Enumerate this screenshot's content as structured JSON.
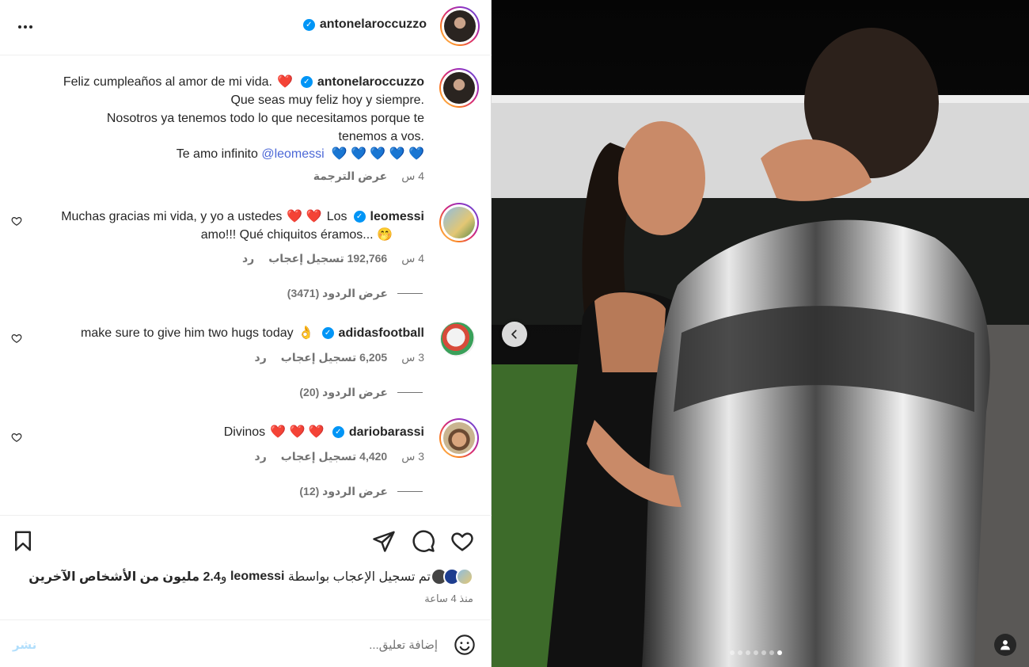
{
  "header": {
    "username": "antonelaroccuzzo"
  },
  "caption": {
    "username": "antonelaroccuzzo",
    "line1": "Feliz cumpleaños al amor de mi vida.",
    "line2": "Que seas muy feliz hoy y siempre.",
    "line3": "Nosotros ya tenemos todo lo que necesitamos porque te",
    "line4": "tenemos a vos.",
    "line5_text": "Te amo infinito",
    "line5_mention": "@leomessi",
    "time": "4 س",
    "translate": "عرض الترجمة"
  },
  "comments": [
    {
      "username": "leomessi",
      "line1_text": "Muchas gracias mi vida, y yo a ustedes",
      "line1_tail": "Los",
      "line2": "amo!!! Qué chiquitos éramos...",
      "time": "4 س",
      "likes": "192,766 تسجيل إعجاب",
      "reply": "رد",
      "view_replies": "عرض الردود (3471)"
    },
    {
      "username": "adidasfootball",
      "text": "make sure to give him two hugs today",
      "time": "3 س",
      "likes": "6,205 تسجيل إعجاب",
      "reply": "رد",
      "view_replies": "عرض الردود (20)"
    },
    {
      "username": "dariobarassi",
      "text": "Divinos",
      "time": "3 س",
      "likes": "4,420 تسجيل إعجاب",
      "reply": "رد",
      "view_replies": "عرض الردود (12)"
    }
  ],
  "likes_summary": {
    "prefix": "تم تسجيل الإعجاب بواسطة",
    "user": "leomessi",
    "mid": "و",
    "others": "2.4 مليون من الأشخاص الآخرين"
  },
  "time_ago": "منذ 4 ساعة",
  "composer": {
    "placeholder": "إضافة تعليق...",
    "post_label": "نشر"
  },
  "carousel": {
    "count": 7,
    "active_index": 6
  },
  "icons": [
    "more-icon",
    "verified-badge-icon",
    "heart-outline-icon",
    "bookmark-icon",
    "share-icon",
    "comment-icon",
    "like-icon",
    "emoji-icon",
    "chevron-left-icon",
    "user-tag-icon"
  ],
  "colors": {
    "verified": "#0095f6",
    "link": "#4c68d7",
    "secondary_text": "#737373",
    "post_button_disabled": "#b2dffc"
  }
}
